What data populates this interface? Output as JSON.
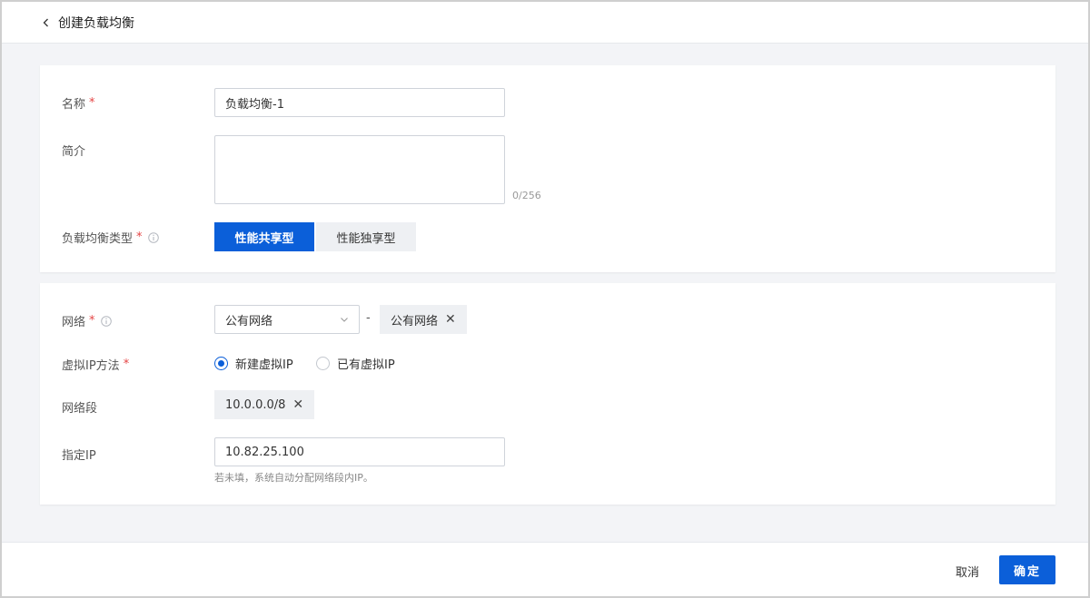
{
  "header": {
    "title": "创建负载均衡"
  },
  "basic": {
    "name_label": "名称",
    "name_value": "负载均衡-1",
    "intro_label": "简介",
    "intro_counter": "0/256",
    "type_label": "负载均衡类型",
    "type_options": [
      "性能共享型",
      "性能独享型"
    ],
    "type_selected": "性能共享型"
  },
  "network": {
    "network_label": "网络",
    "network_select_value": "公有网络",
    "dash": "-",
    "network_tag": "公有网络",
    "vip_label": "虚拟IP方法",
    "vip_options": [
      "新建虚拟IP",
      "已有虚拟IP"
    ],
    "vip_selected": "新建虚拟IP",
    "segment_label": "网络段",
    "segment_tag": "10.0.0.0/8",
    "ip_label": "指定IP",
    "ip_value": "10.82.25.100",
    "ip_hint": "若未填，系统自动分配网络段内IP。"
  },
  "required_mark": "*",
  "footer": {
    "cancel_label": "取消",
    "confirm_label": "确定"
  },
  "colors": {
    "primary": "#0b5fd9",
    "required": "#e54545"
  }
}
